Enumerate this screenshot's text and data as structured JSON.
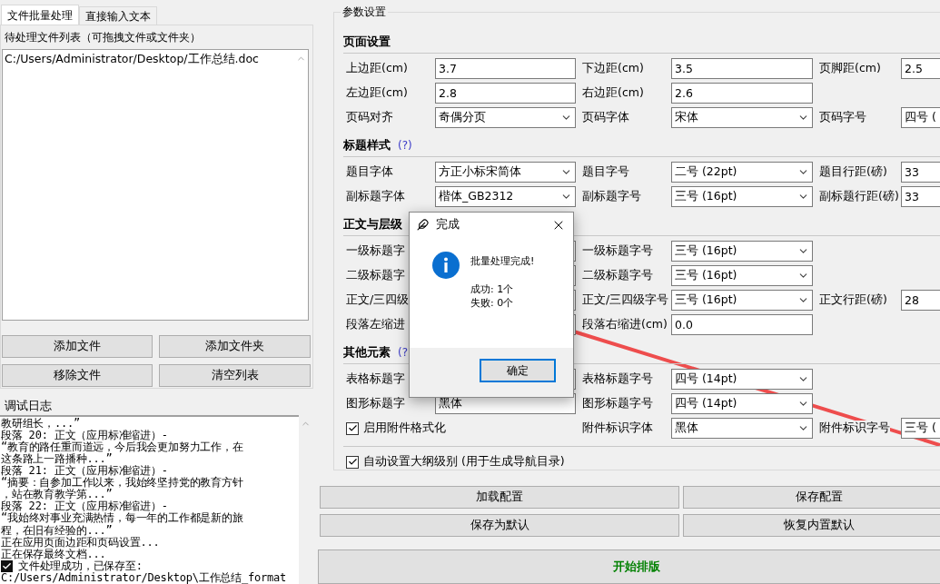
{
  "tabs": [
    {
      "label": "文件批量处理",
      "selected": true
    },
    {
      "label": "直接输入文本",
      "selected": false
    }
  ],
  "file_list": {
    "title": "待处理文件列表（可拖拽文件或文件夹）",
    "items": [
      "C:/Users/Administrator/Desktop/工作总结.doc"
    ]
  },
  "file_buttons": [
    "添加文件",
    "添加文件夹",
    "移除文件",
    "清空列表"
  ],
  "log": {
    "title": "调试日志",
    "lines": [
      {
        "kind": "text",
        "text": "教研组长，...”"
      },
      {
        "kind": "text",
        "text": "段落 20: 正文（应用标准缩进）-"
      },
      {
        "kind": "text",
        "text": "“教育的路任重而道远，今后我会更加努力工作，在"
      },
      {
        "kind": "text",
        "text": "这条路上一路播种...”"
      },
      {
        "kind": "text",
        "text": "段落 21: 正文（应用标准缩进）-"
      },
      {
        "kind": "text",
        "text": "“摘要：自参加工作以来，我始终坚持党的教育方针"
      },
      {
        "kind": "text",
        "text": "，站在教育教学第...”"
      },
      {
        "kind": "text",
        "text": "段落 22: 正文（应用标准缩进）-"
      },
      {
        "kind": "text",
        "text": "“我始终对事业充满热情，每一年的工作都是新的旅"
      },
      {
        "kind": "text",
        "text": "程，在旧有经验的...”"
      },
      {
        "kind": "text",
        "text": "正在应用页面边距和页码设置..."
      },
      {
        "kind": "text",
        "text": "正在保存最终文档..."
      },
      {
        "kind": "success",
        "text": "文件处理成功，已保存至:"
      },
      {
        "kind": "text",
        "text": "C:/Users/Administrator/Desktop\\工作总结_format"
      }
    ]
  },
  "settings": {
    "title": "参数设置",
    "sections": [
      {
        "title": "页面设置",
        "rows": [
          [
            {
              "kind": "text",
              "label": "上边距(cm)",
              "value": "3.7"
            },
            {
              "kind": "text",
              "label": "下边距(cm)",
              "value": "3.5"
            },
            {
              "kind": "text",
              "label": "页脚距(cm)",
              "value": "2.5"
            }
          ],
          [
            {
              "kind": "text",
              "label": "左边距(cm)",
              "value": "2.8"
            },
            {
              "kind": "text",
              "label": "右边距(cm)",
              "value": "2.6"
            }
          ],
          [
            {
              "kind": "select",
              "label": "页码对齐",
              "value": "奇偶分页"
            },
            {
              "kind": "select",
              "label": "页码字体",
              "value": "宋体"
            },
            {
              "kind": "text",
              "label": "页码字号",
              "value": "四号 ("
            }
          ]
        ]
      },
      {
        "title": "标题样式",
        "help": "(?)",
        "rows": [
          [
            {
              "kind": "select",
              "label": "题目字体",
              "value": "方正小标宋简体"
            },
            {
              "kind": "select",
              "label": "题目字号",
              "value": "二号 (22pt)"
            },
            {
              "kind": "text",
              "label": "题目行距(磅)",
              "value": "33"
            }
          ],
          [
            {
              "kind": "select",
              "label": "副标题字体",
              "value": "楷体_GB2312"
            },
            {
              "kind": "select",
              "label": "副标题字号",
              "value": "三号 (16pt)"
            },
            {
              "kind": "text",
              "label": "副标题行距(磅)",
              "value": "33"
            }
          ]
        ]
      },
      {
        "title": "正文与层级",
        "rows": [
          [
            {
              "kind": "text",
              "label": "一级标题字"
            },
            {
              "kind": "select",
              "label": "一级标题字号",
              "value": "三号 (16pt)"
            }
          ],
          [
            {
              "kind": "text",
              "label": "二级标题字"
            },
            {
              "kind": "select",
              "label": "二级标题字号",
              "value": "三号 (16pt)"
            }
          ],
          [
            {
              "kind": "text",
              "label": "正文/三四级"
            },
            {
              "kind": "select",
              "label": "正文/三四级字号",
              "value": "三号 (16pt)"
            },
            {
              "kind": "text",
              "label": "正文行距(磅)",
              "value": "28"
            }
          ],
          [
            {
              "kind": "text",
              "label": "段落左缩进"
            },
            {
              "kind": "text",
              "label": "段落右缩进(cm)",
              "value": "0.0"
            }
          ]
        ]
      },
      {
        "title": "其他元素",
        "help": "(?",
        "rows": [
          [
            {
              "kind": "text",
              "label": "表格标题字"
            },
            {
              "kind": "select",
              "label": "表格标题字号",
              "value": "四号 (14pt)"
            }
          ],
          [
            {
              "kind": "text",
              "label": "图形标题字",
              "value": "黑体"
            },
            {
              "kind": "select",
              "label": "图形标题字号",
              "value": "四号 (14pt)"
            }
          ],
          [
            {
              "kind": "checkbox",
              "label": "启用附件格式化",
              "checked": true
            },
            {
              "kind": "select",
              "label": "附件标识字体",
              "value": "黑体"
            },
            {
              "kind": "text",
              "label": "附件标识字号",
              "value": "三号 ("
            }
          ]
        ]
      }
    ]
  },
  "outline_option": {
    "label": "自动设置大纲级别 (用于生成导航目录)",
    "checked": true
  },
  "config_buttons": [
    "加载配置",
    "保存配置",
    "保存为默认",
    "恢复内置默认"
  ],
  "start_button": "开始排版",
  "dialog": {
    "title": "完成",
    "message": "批量处理完成!",
    "details": [
      "成功: 1个",
      "失败: 0个"
    ],
    "button": "确定"
  }
}
